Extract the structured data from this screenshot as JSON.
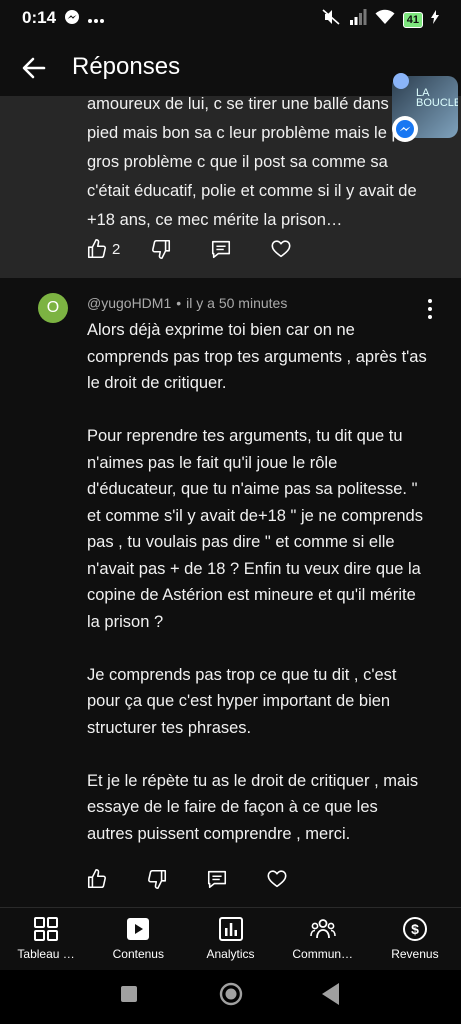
{
  "status": {
    "time": "0:14",
    "battery": "41"
  },
  "header": {
    "title": "Réponses"
  },
  "bubble": {
    "text_line1": "LA",
    "text_line2": "BOUCLE"
  },
  "parent_comment": {
    "text": "amoureux de lui, c se tirer une ballé dans le pied mais bon sa c leur problème mais le plus gros problème c que il post sa comme sa c'était éducatif, polie et comme si il y avait de +18 ans, ce mec mérite la prison…",
    "like_count": "2"
  },
  "reply": {
    "avatar_letter": "O",
    "author": "@yugoHDM1",
    "separator": "•",
    "time": "il y a 50 minutes",
    "paragraphs": [
      "Alors déjà exprime toi bien car on ne comprends pas trop tes arguments , après t'as le droit de critiquer.",
      "Pour reprendre tes arguments,  tu dit que tu n'aimes pas le fait qu'il joue le rôle d'éducateur,  que tu n'aime pas sa politesse. \" et comme s'il y avait de+18 \" je ne comprends pas  , tu voulais pas dire \" et comme si elle n'avait pas + de 18 ? Enfin tu veux dire que la copine de Astérion est mineure et qu'il mérite la prison ?",
      "Je comprends pas trop ce que tu dit , c'est pour ça que c'est hyper important de bien structurer tes phrases.",
      "Et je le répète tu as le droit de critiquer , mais essaye de le faire de façon à ce que les autres puissent comprendre , merci."
    ]
  },
  "bottom_nav": [
    {
      "label": "Tableau …",
      "icon": "dashboard-icon"
    },
    {
      "label": "Contenus",
      "icon": "content-icon"
    },
    {
      "label": "Analytics",
      "icon": "analytics-icon"
    },
    {
      "label": "Commun…",
      "icon": "community-icon"
    },
    {
      "label": "Revenus",
      "icon": "revenue-icon"
    }
  ]
}
